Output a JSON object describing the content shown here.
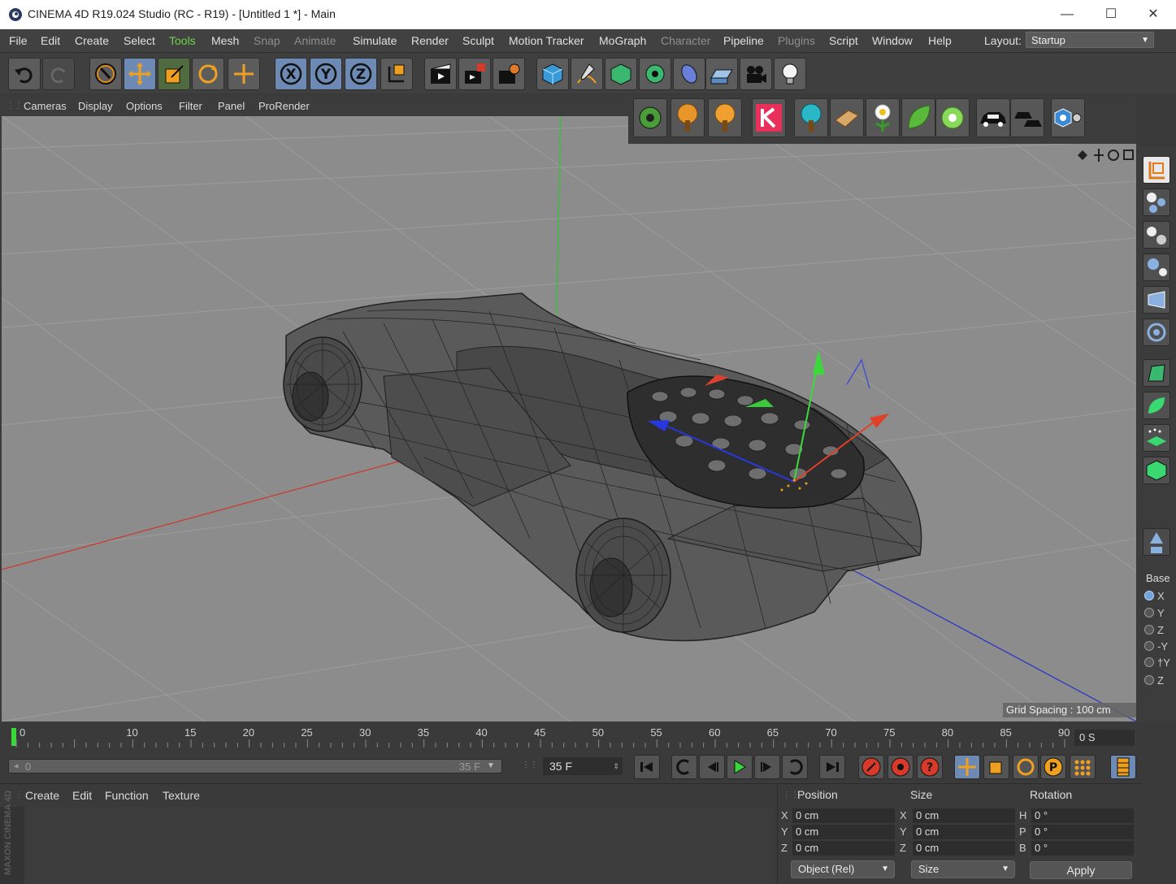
{
  "window": {
    "title": "CINEMA 4D R19.024 Studio (RC - R19) - [Untitled 1 *] - Main",
    "minimize": "—",
    "maximize": "☐",
    "close": "✕"
  },
  "menu": {
    "items": [
      "File",
      "Edit",
      "Create",
      "Select",
      "Tools",
      "Mesh",
      "Snap",
      "Animate",
      "Simulate",
      "Render",
      "Sculpt",
      "Motion Tracker",
      "MoGraph",
      "Character",
      "Pipeline",
      "Plugins",
      "Script",
      "Window",
      "Help"
    ],
    "layout_label": "Layout:",
    "layout_value": "Startup"
  },
  "toolbar": {
    "buttons": [
      "undo-icon",
      "redo-icon",
      "live-selection-icon",
      "move-icon",
      "scale-icon",
      "rotate-icon",
      "last-tool-icon",
      "lock-x-icon",
      "lock-y-icon",
      "lock-z-icon",
      "coordinate-system-icon",
      "render-view-icon",
      "render-picture-viewer-icon",
      "render-settings-icon",
      "cube-icon",
      "pen-spline-icon",
      "subdivision-icon",
      "array-icon",
      "deformer-icon",
      "floor-icon",
      "camera-icon",
      "light-icon"
    ],
    "xyz": [
      "X",
      "Y",
      "Z"
    ]
  },
  "viewport_menu": [
    "Cameras",
    "Display",
    "Options",
    "Filter",
    "Panel",
    "ProRender"
  ],
  "plugins": [
    "gear-plugin-icon",
    "tree-orange-icon",
    "tree-orange2-icon",
    "k-logo-icon",
    "tree-cyan-icon",
    "wood-icon",
    "flower-icon",
    "leaf-icon",
    "flower-green-icon",
    "car-icon",
    "car-lane-icon",
    "settings-hex-icon"
  ],
  "viewport": {
    "grid_spacing": "Grid Spacing : 100 cm"
  },
  "right_palette": {
    "base_label": "Base",
    "axes": [
      "X",
      "Y",
      "Z",
      "-Y",
      "†Y",
      "Z"
    ]
  },
  "timeline": {
    "ticks": [
      "0",
      "10",
      "15",
      "20",
      "25",
      "30",
      "35",
      "40",
      "45",
      "50",
      "55",
      "60",
      "65",
      "70",
      "75",
      "80",
      "85",
      "90"
    ],
    "time_field": "0 S"
  },
  "transport": {
    "range_start": "0",
    "range_end": "35 F",
    "current_frame": "35 F"
  },
  "material_manager": {
    "menu": [
      "Create",
      "Edit",
      "Function",
      "Texture"
    ],
    "watermark": "MAXON CINEMA 4D"
  },
  "coordinates": {
    "headers": [
      "Position",
      "Size",
      "Rotation"
    ],
    "position": [
      {
        "axis": "X",
        "value": "0 cm"
      },
      {
        "axis": "Y",
        "value": "0 cm"
      },
      {
        "axis": "Z",
        "value": "0 cm"
      }
    ],
    "size": [
      {
        "axis": "X",
        "value": "0 cm"
      },
      {
        "axis": "Y",
        "value": "0 cm"
      },
      {
        "axis": "Z",
        "value": "0 cm"
      }
    ],
    "rotation": [
      {
        "axis": "H",
        "value": "0 °"
      },
      {
        "axis": "P",
        "value": "0 °"
      },
      {
        "axis": "B",
        "value": "0 °"
      }
    ],
    "mode": "Object (Rel)",
    "size_mode": "Size",
    "apply": "Apply"
  },
  "colors": {
    "accent_active": "#6fd14a",
    "toolbar_on": "#6c8ab4",
    "viewport_bg": "#8c8c8c",
    "axis_x": "#e03a2a",
    "axis_y": "#3ad13a",
    "axis_z": "#2a3ae0"
  }
}
